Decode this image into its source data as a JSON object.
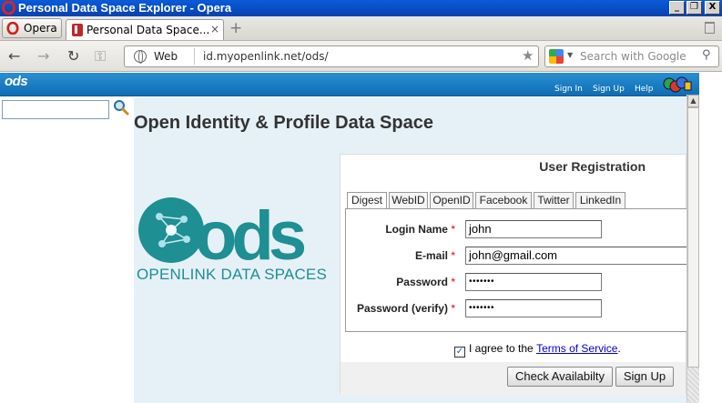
{
  "window": {
    "title": "Personal Data Space Explorer - Opera",
    "min": "_",
    "restore": "❐",
    "close": "X"
  },
  "tabbar": {
    "menu_label": "Opera",
    "tab_title": "Personal Data Space...",
    "tab_close": "×",
    "new_tab": "+"
  },
  "addressbar": {
    "mode_label": "Web",
    "url": "id.myopenlink.net/ods/",
    "search_placeholder": "Search with Google",
    "back": "←",
    "forward": "→",
    "reload": "↻",
    "key": "⚿",
    "star": "★",
    "search_icon": "⚲",
    "engine_dropdown": "▼"
  },
  "ods_header": {
    "logo": "ods",
    "links": [
      "Sign In",
      "Sign Up",
      "Help"
    ]
  },
  "page": {
    "title": "Open Identity & Profile Data Space",
    "logo_text": "OPENLINK DATA SPACES",
    "logo_letters": "ods"
  },
  "registration": {
    "title": "User Registration",
    "tabs": [
      "Digest",
      "WebID",
      "OpenID",
      "Facebook",
      "Twitter",
      "LinkedIn"
    ],
    "active_tab": "Digest",
    "required_mark": "*",
    "fields": [
      {
        "label": "Login Name",
        "value": "john"
      },
      {
        "label": "E-mail",
        "value": "john@gmail.com"
      },
      {
        "label": "Password",
        "value": "•••••••"
      },
      {
        "label": "Password (verify)",
        "value": "•••••••"
      }
    ],
    "agree_text": "I agree to the",
    "terms_link": "Terms of Service",
    "agree_suffix": ".",
    "checkbox_mark": "✓",
    "buttons": {
      "check": "Check Availabilty",
      "signup": "Sign Up"
    }
  },
  "scrollbar": {
    "up": "▲"
  },
  "colors": {
    "titlebar": "#0a5bd8",
    "ods_header": "#1a7ec4",
    "logo_teal": "#1e8f93",
    "content_bg": "#e6f1f7"
  }
}
